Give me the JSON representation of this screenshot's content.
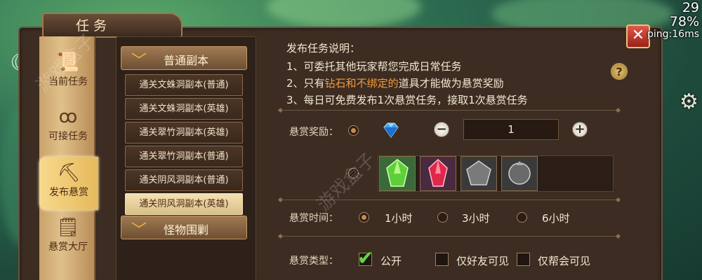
{
  "hud": {
    "fps": "29",
    "battery": "78%",
    "ping": "ping:16ms"
  },
  "window": {
    "title": "任务"
  },
  "nav": {
    "items": [
      {
        "label": "当前任务",
        "icon": "scroll-icon",
        "active": false
      },
      {
        "label": "可接任务",
        "icon": "swirl-icon",
        "active": false
      },
      {
        "label": "发布悬赏",
        "icon": "shovel-icon",
        "active": true
      },
      {
        "label": "悬赏大厅",
        "icon": "notice-icon",
        "active": false
      }
    ]
  },
  "dungeon_list": {
    "category_1": "普通副本",
    "items": [
      "通关文蛛洞副本(普通)",
      "通关文蛛洞副本(英雄)",
      "通关翠竹洞副本(英雄)",
      "通关翠竹洞副本(普通)",
      "通关阴风洞副本(普通)",
      "通关阴风洞副本(英雄)"
    ],
    "selected_index": 5,
    "category_2": "怪物围剿"
  },
  "description": {
    "title": "发布任务说明：",
    "line1": "1、可委托其他玩家帮您完成日常任务",
    "line2_prefix": "2、只有",
    "line2_highlight": "钻石和不绑定的",
    "line2_suffix": "道具才能做为悬赏奖励",
    "line3": "3、每日可免费发布1次悬赏任务，接取1次悬赏任务",
    "help": "?"
  },
  "reward": {
    "label": "悬赏奖励：",
    "quantity": "1",
    "minus": "−",
    "plus": "+",
    "item_icons": [
      "green-gem-icon",
      "red-gem-icon",
      "grey-pentagon-stone-icon",
      "grey-orb-stone-icon"
    ]
  },
  "time": {
    "label": "悬赏时间：",
    "options": [
      "1小时",
      "3小时",
      "6小时"
    ],
    "selected": 0
  },
  "type": {
    "label": "悬赏类型：",
    "options": [
      "公开",
      "仅好友可见",
      "仅帮会可见"
    ],
    "checked": 0
  },
  "watermark": "游戏盒子",
  "colors": {
    "highlight": "#f39a3a",
    "panel": "#3c2c22",
    "gold": "#e6b95c"
  }
}
